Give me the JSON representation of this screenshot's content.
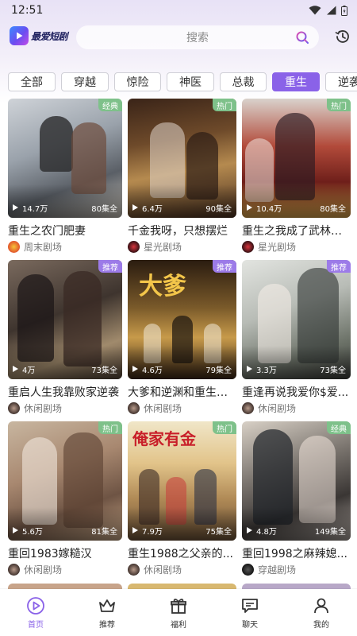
{
  "status_bar": {
    "time": "12:51"
  },
  "header": {
    "logo_text": "最爱短剧",
    "search_placeholder": "搜索"
  },
  "tabs": [
    {
      "label": "全部",
      "active": false
    },
    {
      "label": "穿越",
      "active": false
    },
    {
      "label": "惊险",
      "active": false
    },
    {
      "label": "神医",
      "active": false
    },
    {
      "label": "总裁",
      "active": false
    },
    {
      "label": "重生",
      "active": true
    },
    {
      "label": "逆袭",
      "active": false
    }
  ],
  "colors": {
    "accent": "#8a62e8",
    "badge_classic": "#7ec18a",
    "badge_hot": "#7ec18a",
    "badge_recommend": "#9c7be8"
  },
  "dramas": [
    {
      "badge": "经典",
      "views": "14.7万",
      "episodes": "80集全",
      "title": "重生之农门肥妻",
      "source": "周末剧场"
    },
    {
      "badge": "热门",
      "views": "6.4万",
      "episodes": "90集全",
      "title": "千金我呀，只想摆烂",
      "source": "星光剧场"
    },
    {
      "badge": "热门",
      "views": "10.4万",
      "episodes": "80集全",
      "title": "重生之我成了武林盟...",
      "source": "星光剧场"
    },
    {
      "badge": "推荐",
      "views": "4万",
      "episodes": "73集全",
      "title": "重启人生我靠败家逆袭",
      "source": "休闲剧场"
    },
    {
      "badge": "推荐",
      "views": "4.6万",
      "episodes": "79集全",
      "title": "大爹和逆渊和重生成...",
      "source": "休闲剧场"
    },
    {
      "badge": "推荐",
      "views": "3.3万",
      "episodes": "73集全",
      "title": "重逢再说我爱你$爱...",
      "source": "休闲剧场"
    },
    {
      "badge": "热门",
      "views": "5.6万",
      "episodes": "81集全",
      "title": "重回1983嫁糙汉",
      "source": "休闲剧场"
    },
    {
      "badge": "热门",
      "views": "7.9万",
      "episodes": "75集全",
      "title": "重生1988之父亲的...",
      "source": "休闲剧场"
    },
    {
      "badge": "经典",
      "views": "4.8万",
      "episodes": "149集全",
      "title": "重回1998之麻辣媳...",
      "source": "穿越剧场"
    }
  ],
  "bottom_nav": [
    {
      "label": "首页",
      "icon": "home-play-icon",
      "active": true
    },
    {
      "label": "推荐",
      "icon": "crown-icon",
      "active": false
    },
    {
      "label": "福利",
      "icon": "gift-icon",
      "active": false
    },
    {
      "label": "聊天",
      "icon": "chat-icon",
      "active": false
    },
    {
      "label": "我的",
      "icon": "profile-icon",
      "active": false
    }
  ]
}
